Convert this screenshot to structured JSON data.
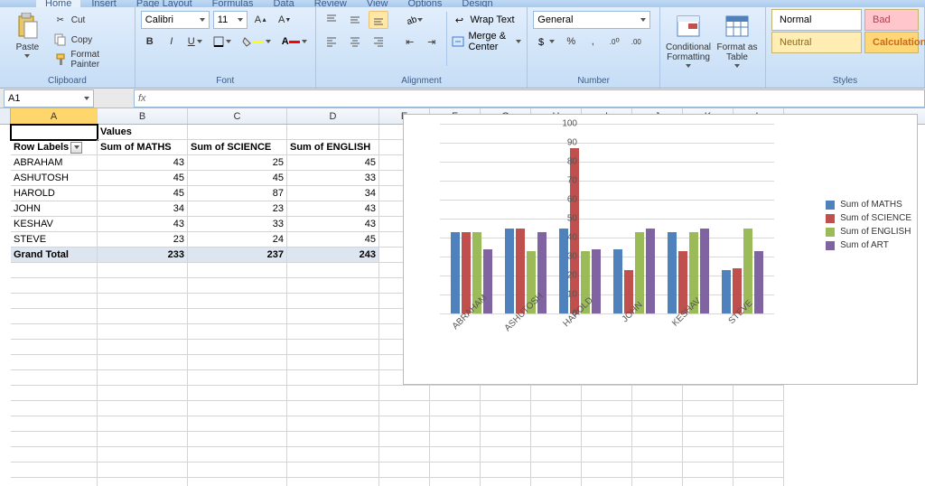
{
  "tabs": [
    "Home",
    "Insert",
    "Page Layout",
    "Formulas",
    "Data",
    "Review",
    "View",
    "Options",
    "Design"
  ],
  "clipboard": {
    "label": "Clipboard",
    "paste": "Paste",
    "cut": "Cut",
    "copy": "Copy",
    "painter": "Format Painter"
  },
  "font": {
    "label": "Font",
    "name": "Calibri",
    "size": "11"
  },
  "alignment": {
    "label": "Alignment",
    "wrap": "Wrap Text",
    "merge": "Merge & Center"
  },
  "number": {
    "label": "Number",
    "format": "General"
  },
  "cond": {
    "label": "Conditional Formatting"
  },
  "fmtTable": {
    "label": "Format as Table"
  },
  "styles": {
    "label": "Styles",
    "normal": "Normal",
    "bad": "Bad",
    "neutral": "Neutral",
    "calc": "Calculation"
  },
  "namebox": "A1",
  "columns": {
    "A": 96,
    "B": 100,
    "C": 110,
    "D": 102,
    "E": 56,
    "F": 56,
    "G": 56,
    "H": 56,
    "I": 56,
    "J": 56,
    "K": 56,
    "L": 56
  },
  "pivot": {
    "rowLabelsHdr": "Row Labels",
    "valuesHdr": "Values",
    "cols": [
      "Sum of MATHS",
      "Sum of SCIENCE",
      "Sum of ENGLISH"
    ],
    "rows": [
      {
        "name": "ABRAHAM",
        "v": [
          43,
          25,
          45
        ]
      },
      {
        "name": "ASHUTOSH",
        "v": [
          45,
          45,
          33
        ]
      },
      {
        "name": "HAROLD",
        "v": [
          45,
          87,
          34
        ]
      },
      {
        "name": "JOHN",
        "v": [
          34,
          23,
          43
        ]
      },
      {
        "name": "KESHAV",
        "v": [
          43,
          33,
          43
        ]
      },
      {
        "name": "STEVE",
        "v": [
          23,
          24,
          45
        ]
      }
    ],
    "grand": {
      "label": "Grand Total",
      "v": [
        233,
        237,
        243
      ]
    }
  },
  "chart_data": {
    "type": "bar",
    "categories": [
      "ABRAHAM",
      "ASHUTOSH",
      "HAROLD",
      "JOHN",
      "KESHAV",
      "STEVE"
    ],
    "series": [
      {
        "name": "Sum of MATHS",
        "values": [
          43,
          45,
          45,
          34,
          43,
          23
        ],
        "color": "#4f81bd"
      },
      {
        "name": "Sum of SCIENCE",
        "values": [
          43,
          45,
          87,
          23,
          33,
          24
        ],
        "color": "#c0504d"
      },
      {
        "name": "Sum of ENGLISH",
        "values": [
          43,
          33,
          33,
          43,
          43,
          45
        ],
        "color": "#9bbb59"
      },
      {
        "name": "Sum of ART",
        "values": [
          34,
          43,
          34,
          45,
          45,
          33
        ],
        "color": "#8064a2"
      }
    ],
    "ylim": [
      0,
      100
    ],
    "yticks": [
      0,
      10,
      20,
      30,
      40,
      50,
      60,
      70,
      80,
      90,
      100
    ]
  }
}
